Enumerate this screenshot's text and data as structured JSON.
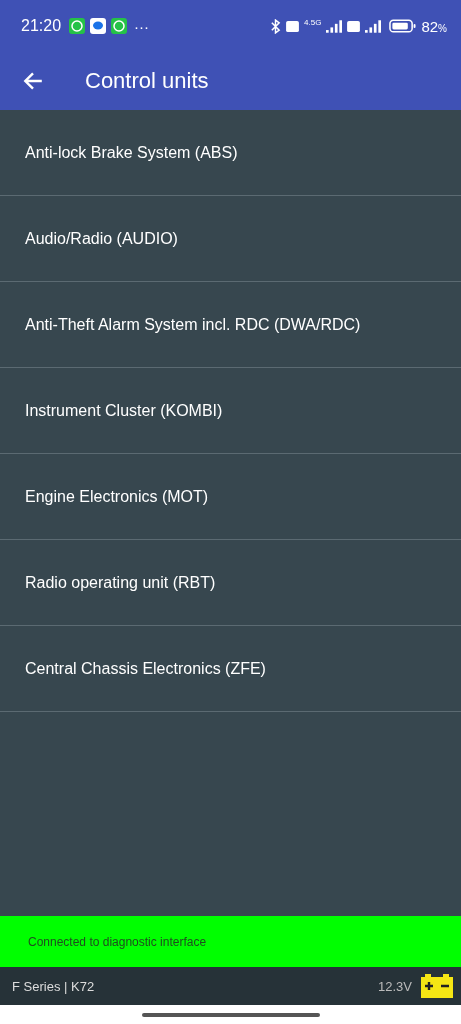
{
  "status_bar": {
    "time": "21:20",
    "more": "···",
    "network": "4.5G",
    "battery": "82",
    "battery_unit": "%"
  },
  "app_bar": {
    "title": "Control units"
  },
  "control_units": [
    {
      "label": "Anti-lock Brake System (ABS)"
    },
    {
      "label": "Audio/Radio (AUDIO)"
    },
    {
      "label": "Anti-Theft Alarm System incl. RDC (DWA/RDC)"
    },
    {
      "label": "Instrument Cluster (KOMBI)"
    },
    {
      "label": "Engine Electronics (MOT)"
    },
    {
      "label": "Radio operating unit (RBT)"
    },
    {
      "label": "Central Chassis Electronics (ZFE)"
    }
  ],
  "connection_banner": {
    "text": "Connected to diagnostic interface"
  },
  "footer": {
    "vehicle": "F Series | K72",
    "voltage": "12.3V"
  }
}
